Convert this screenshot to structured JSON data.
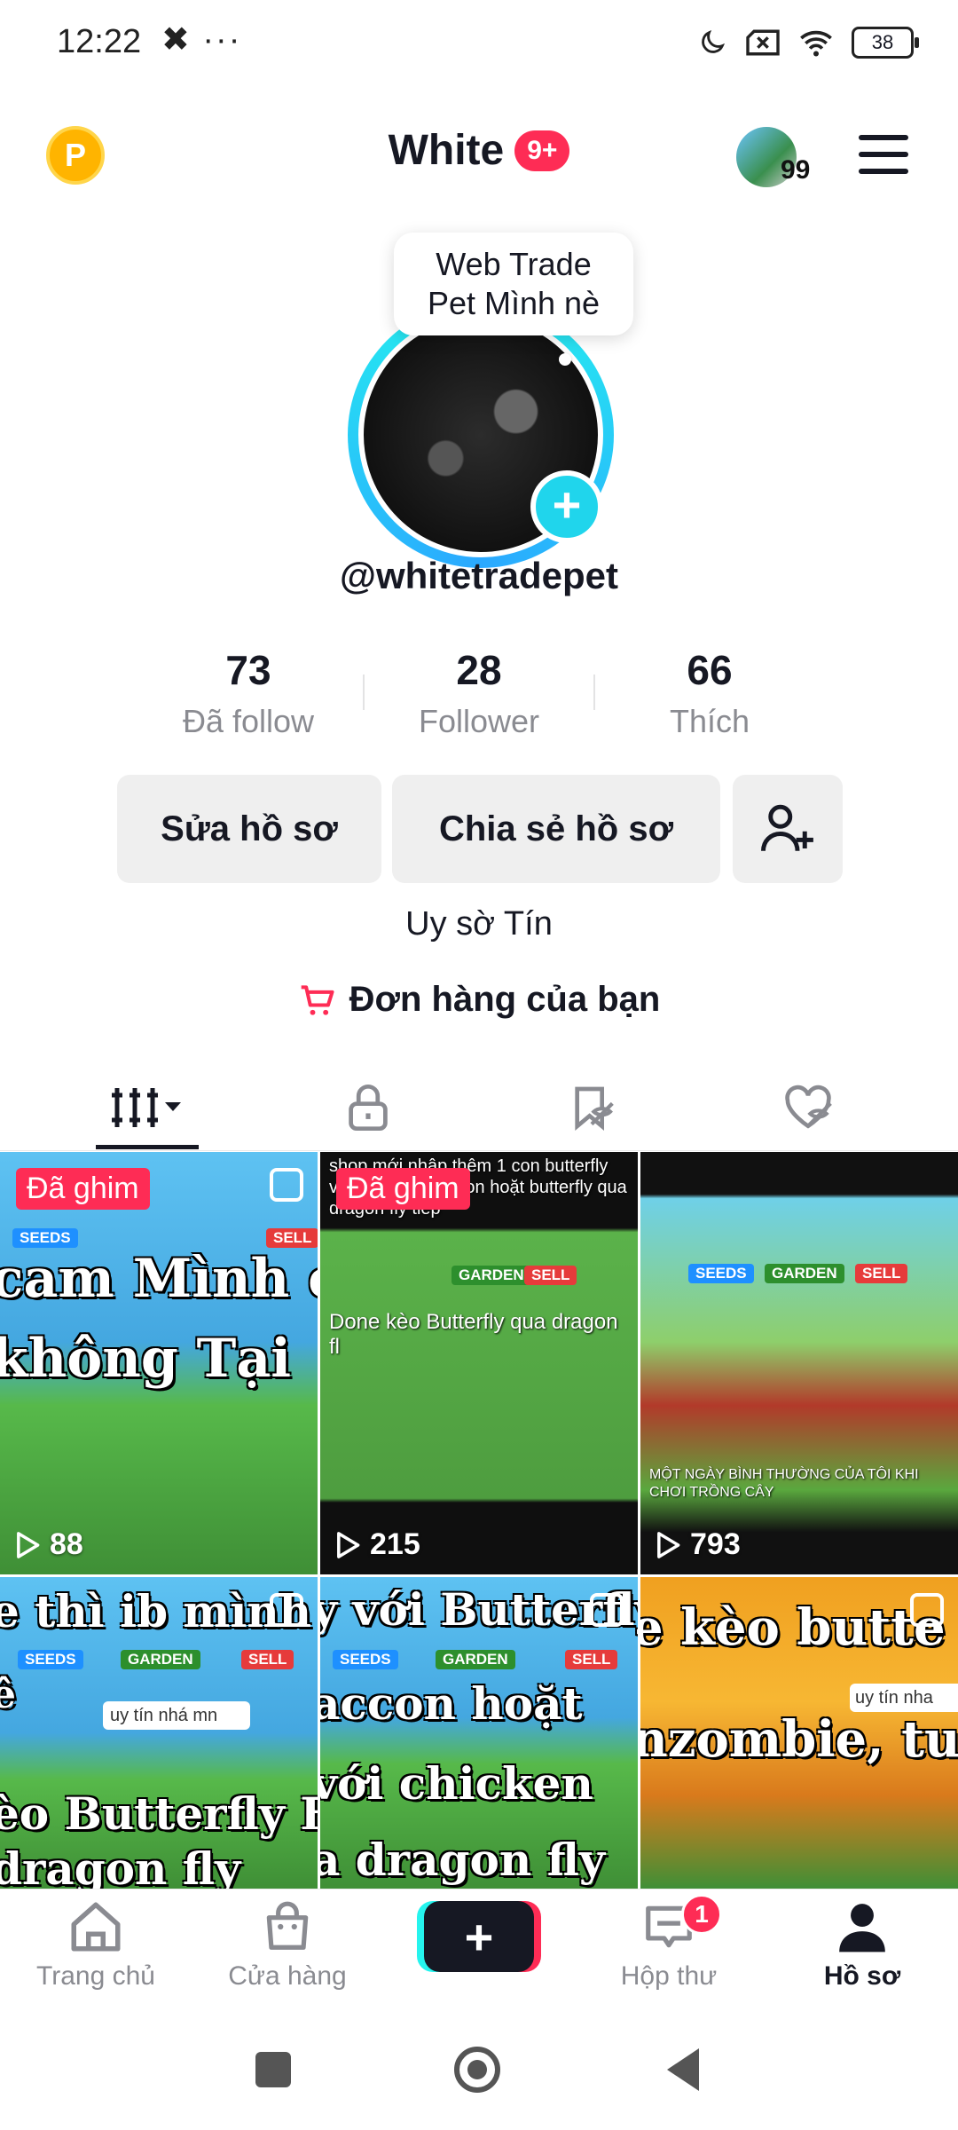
{
  "status_bar": {
    "time": "12:22",
    "extra": "✖ ···",
    "battery": "38"
  },
  "header": {
    "coin_letter": "P",
    "title": "White",
    "title_badge": "9+",
    "avatar_count": "99"
  },
  "profile": {
    "bubble_line1": "Web Trade",
    "bubble_line2": "Pet Mình nè",
    "username": "@whitetradepet",
    "stats": [
      {
        "value": "73",
        "label": "Đã follow"
      },
      {
        "value": "28",
        "label": "Follower"
      },
      {
        "value": "66",
        "label": "Thích"
      }
    ],
    "buttons": {
      "edit": "Sửa hồ sơ",
      "share": "Chia sẻ hồ sơ"
    },
    "bio": "Uy sờ Tín",
    "orders": "Đơn hàng của bạn"
  },
  "grid": {
    "pinned_label": "Đã ghim",
    "tiles": [
      {
        "views": "88",
        "caption1": "cam Mình c",
        "caption2": "không Tại"
      },
      {
        "views": "215",
        "top_text": "shop mới nhập thêm 1 con butterfly và cần trade raccon hoặt butterfly qua dragon fly tiếp",
        "sub_text": "Done kèo Butterfly qua dragon fl"
      },
      {
        "views": "793",
        "sub_text": "MỘT NGÀY BÌNH THƯỜNG CỦA TÔI KHI CHƠI TRỒNG CÂY"
      },
      {
        "caption1": "e thì ib mình",
        "caption2": "ê",
        "caption3": "èo Butterfly Fly",
        "caption4": "dragon fly",
        "note": "uy tín nhá mn"
      },
      {
        "caption1": "y với Butterfly",
        "caption2": "accon hoặt",
        "caption3": "với chicken",
        "caption4": "a dragon fly"
      },
      {
        "caption1": "e kèo butte",
        "caption2": "nzombie, tui",
        "note": "uy tín nha"
      }
    ],
    "chips": {
      "seeds": "SEEDS",
      "garden": "GARDEN",
      "sell": "SELL"
    }
  },
  "bottom_nav": {
    "home": "Trang chủ",
    "shop": "Cửa hàng",
    "inbox": "Hộp thư",
    "inbox_badge": "1",
    "profile": "Hồ sơ"
  }
}
